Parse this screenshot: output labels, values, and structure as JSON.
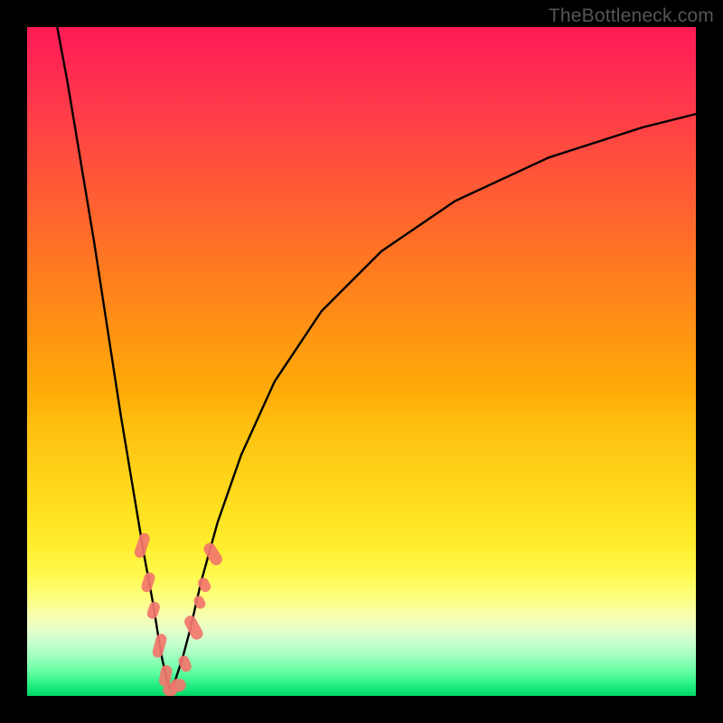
{
  "watermark": "TheBottleneck.com",
  "chart_data": {
    "type": "line",
    "title": "",
    "xlabel": "",
    "ylabel": "",
    "xlim": [
      0,
      100
    ],
    "ylim": [
      0,
      100
    ],
    "grid": false,
    "legend": false,
    "gradient_stops": [
      {
        "pos": 0,
        "color": "#ff1a55"
      },
      {
        "pos": 50,
        "color": "#ff9a10"
      },
      {
        "pos": 82,
        "color": "#fffa50"
      },
      {
        "pos": 100,
        "color": "#00d868"
      }
    ],
    "series": [
      {
        "name": "bottleneck-curve-left",
        "color": "#000000",
        "x": [
          4.5,
          6,
          8,
          10,
          12,
          14,
          16,
          17.5,
          18.8,
          19.6,
          20.2,
          20.8,
          21.3
        ],
        "y": [
          100,
          92,
          80,
          68,
          55,
          42,
          30,
          21,
          14,
          9,
          5.5,
          2.8,
          1.2
        ]
      },
      {
        "name": "bottleneck-curve-right",
        "color": "#000000",
        "x": [
          21.3,
          22.2,
          23.2,
          24.4,
          26,
          28.5,
          32,
          37,
          44,
          53,
          64,
          78,
          92,
          100
        ],
        "y": [
          1.2,
          2.5,
          5.5,
          10,
          17,
          26,
          36,
          47,
          57.5,
          66.5,
          74,
          80.5,
          85,
          87
        ]
      },
      {
        "name": "data-markers",
        "color": "#f2766d",
        "marker": "pill",
        "points": [
          {
            "x": 17.2,
            "y": 22.5,
            "w": 1.6,
            "h": 3.8,
            "rot": 18
          },
          {
            "x": 18.1,
            "y": 17.0,
            "w": 1.6,
            "h": 3.0,
            "rot": 18
          },
          {
            "x": 18.9,
            "y": 12.8,
            "w": 1.6,
            "h": 2.6,
            "rot": 18
          },
          {
            "x": 19.8,
            "y": 7.5,
            "w": 1.6,
            "h": 3.6,
            "rot": 15
          },
          {
            "x": 20.7,
            "y": 3.0,
            "w": 1.7,
            "h": 3.2,
            "rot": 10
          },
          {
            "x": 21.4,
            "y": 0.9,
            "w": 2.2,
            "h": 1.9,
            "rot": 0
          },
          {
            "x": 22.6,
            "y": 1.6,
            "w": 2.3,
            "h": 1.9,
            "rot": 0
          },
          {
            "x": 23.6,
            "y": 4.8,
            "w": 1.6,
            "h": 2.5,
            "rot": -22
          },
          {
            "x": 24.9,
            "y": 10.2,
            "w": 1.8,
            "h": 3.8,
            "rot": -28
          },
          {
            "x": 25.8,
            "y": 14.0,
            "w": 1.5,
            "h": 2.0,
            "rot": -28
          },
          {
            "x": 26.5,
            "y": 16.6,
            "w": 1.6,
            "h": 2.2,
            "rot": -30
          },
          {
            "x": 27.8,
            "y": 21.2,
            "w": 1.8,
            "h": 3.6,
            "rot": -32
          }
        ]
      }
    ]
  }
}
